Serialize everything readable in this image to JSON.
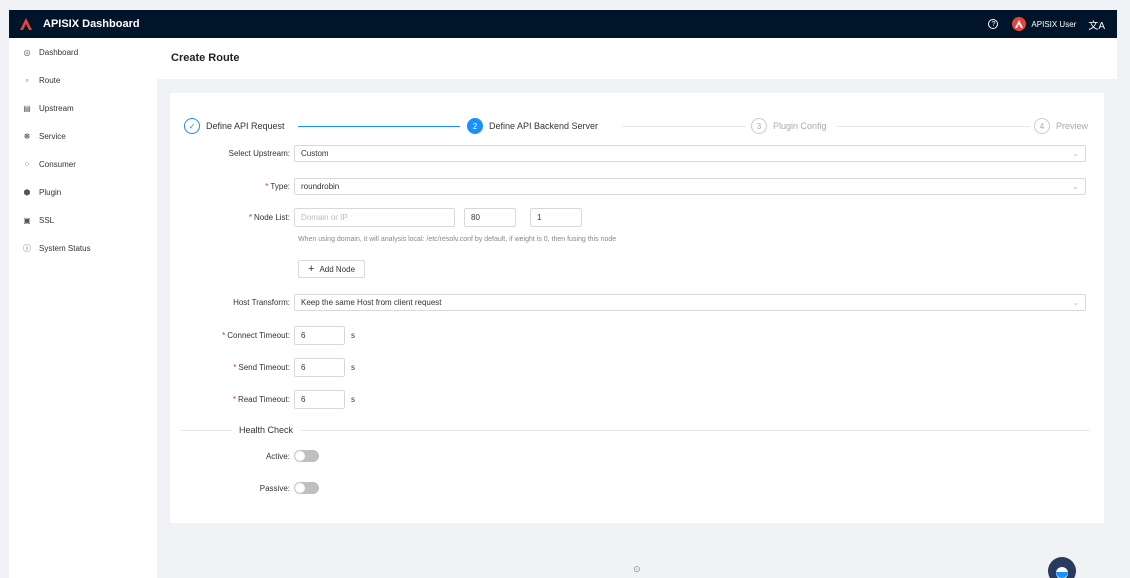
{
  "header": {
    "brand": "APISIX Dashboard",
    "help_glyph": "?",
    "user_name": "APISIX User",
    "lang_glyph": "文A"
  },
  "sidebar": {
    "items": [
      {
        "label": "Dashboard",
        "icon": "dashboard-icon",
        "glyph": "◎"
      },
      {
        "label": "Route",
        "icon": "route-icon",
        "glyph": "▫"
      },
      {
        "label": "Upstream",
        "icon": "upstream-icon",
        "glyph": "▤"
      },
      {
        "label": "Service",
        "icon": "service-icon",
        "glyph": "❋"
      },
      {
        "label": "Consumer",
        "icon": "consumer-icon",
        "glyph": "⁘"
      },
      {
        "label": "Plugin",
        "icon": "plugin-icon",
        "glyph": "⬢"
      },
      {
        "label": "SSL",
        "icon": "ssl-icon",
        "glyph": "▣"
      },
      {
        "label": "System Status",
        "icon": "info-icon",
        "glyph": "ⓘ"
      }
    ]
  },
  "page": {
    "title": "Create Route"
  },
  "steps": [
    {
      "title": "Define API Request",
      "status": "done",
      "mark": "✓"
    },
    {
      "title": "Define API Backend Server",
      "status": "active",
      "mark": "2"
    },
    {
      "title": "Plugin Config",
      "status": "wait",
      "mark": "3"
    },
    {
      "title": "Preview",
      "status": "wait",
      "mark": "4"
    }
  ],
  "form": {
    "select_upstream": {
      "label": "Select Upstream",
      "value": "Custom"
    },
    "type": {
      "label": "Type",
      "value": "roundrobin"
    },
    "node_list": {
      "label": "Node List",
      "host_placeholder": "Domain or IP",
      "port": "80",
      "weight": "1",
      "hint": "When using domain, it will analysis local: /etc/resolv.conf by default, if weight is 0, then fusing this node",
      "add_label": "Add Node"
    },
    "host_transform": {
      "label": "Host Transform",
      "value": "Keep the same Host from client request"
    },
    "connect_timeout": {
      "label": "Connect Timeout",
      "value": "6",
      "unit": "s"
    },
    "send_timeout": {
      "label": "Send Timeout",
      "value": "6",
      "unit": "s"
    },
    "read_timeout": {
      "label": "Read Timeout",
      "value": "6",
      "unit": "s"
    },
    "health_check": {
      "title": "Health Check",
      "active_label": "Active",
      "active_on": false,
      "passive_label": "Passive",
      "passive_on": false
    }
  },
  "colors": {
    "primary": "#1890ff",
    "nav_bg": "#001529",
    "required": "#f5222d"
  }
}
